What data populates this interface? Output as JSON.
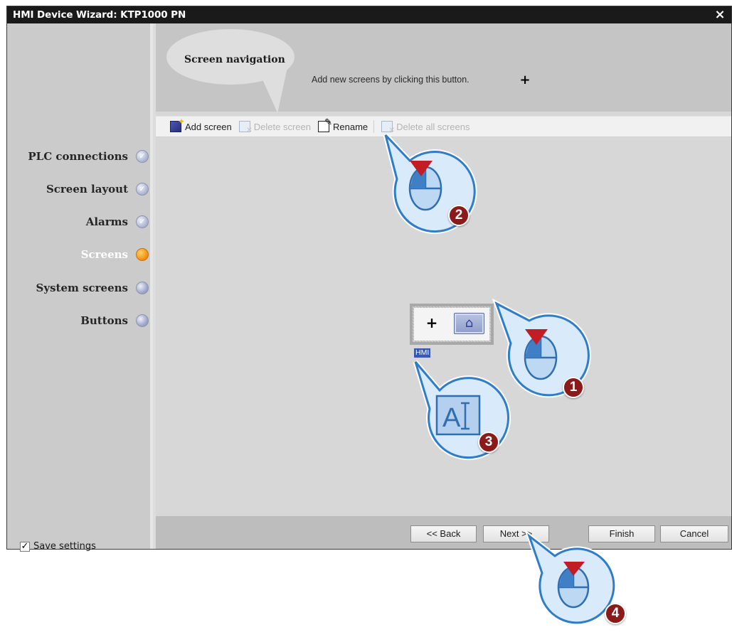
{
  "window": {
    "title": "HMI Device Wizard: KTP1000 PN",
    "close_label": "×"
  },
  "sidebar": {
    "steps": [
      {
        "label": "PLC connections",
        "state": "done"
      },
      {
        "label": "Screen layout",
        "state": "done"
      },
      {
        "label": "Alarms",
        "state": "done"
      },
      {
        "label": "Screens",
        "state": "current"
      },
      {
        "label": "System screens",
        "state": "pending"
      },
      {
        "label": "Buttons",
        "state": "pending"
      }
    ],
    "save_settings": {
      "label": "Save settings",
      "checked": true
    }
  },
  "header": {
    "title": "Screen navigation",
    "hint": "Add new screens by clicking this button.",
    "plus_glyph": "+"
  },
  "toolbar": {
    "add_screen": "Add screen",
    "delete_screen": "Delete screen",
    "rename": "Rename",
    "delete_all": "Delete all screens"
  },
  "canvas": {
    "node_plus_glyph": "+",
    "home_glyph": "⌂",
    "screen_label": "HMI"
  },
  "footer": {
    "back": "<< Back",
    "next": "Next >>",
    "finish": "Finish",
    "cancel": "Cancel"
  },
  "callouts": [
    {
      "number": "1",
      "icon": "mouse-left-click"
    },
    {
      "number": "2",
      "icon": "mouse-left-click"
    },
    {
      "number": "3",
      "icon": "text-cursor",
      "glyph": "AI"
    },
    {
      "number": "4",
      "icon": "mouse-left-click"
    }
  ],
  "colors": {
    "titlebar": "#1a1a1a",
    "callout_fill": "#cfe4f7",
    "callout_border": "#2f7cc7",
    "callout_badge": "#8b1a1a",
    "active_step_dot": "#f59b1c"
  }
}
